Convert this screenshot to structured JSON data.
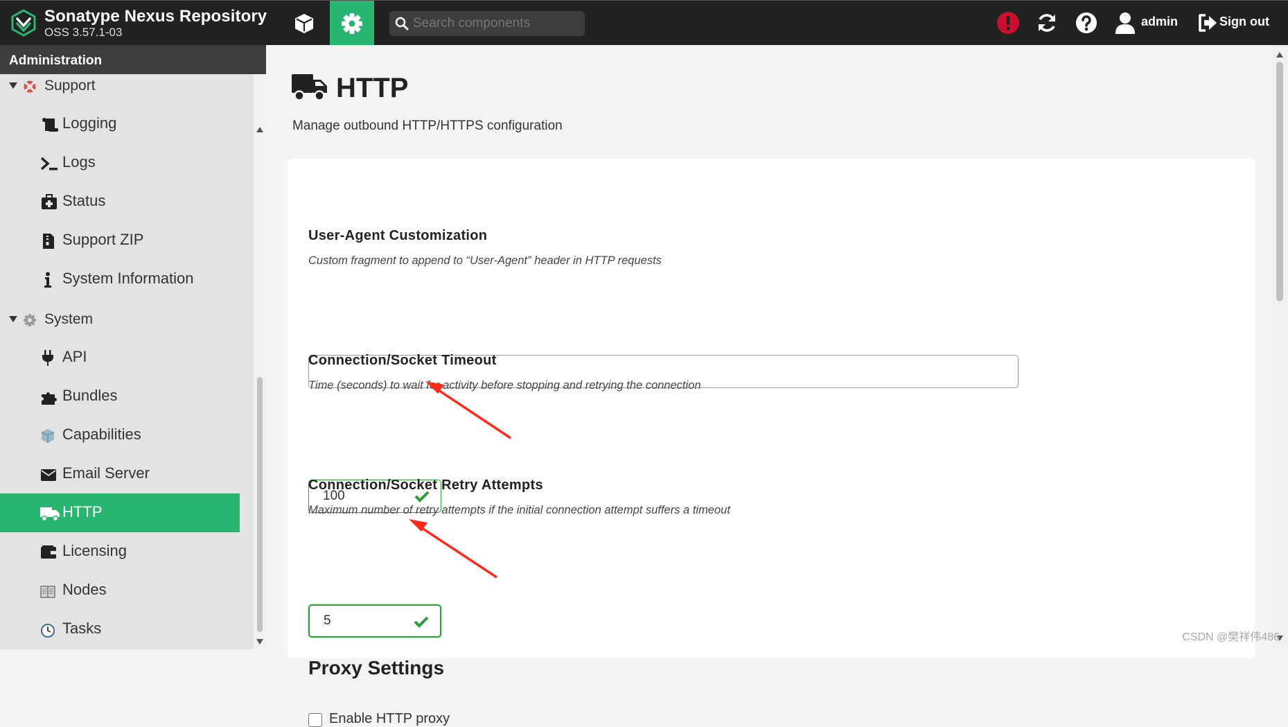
{
  "topbar": {
    "brand_name": "Sonatype Nexus Repository",
    "brand_version": "OSS 3.57.1-03",
    "search_placeholder": "Search components",
    "user_name": "admin",
    "signout_label": "Sign out",
    "icons": [
      "nexus-logo-icon",
      "cube-icon",
      "gear-icon",
      "search-icon",
      "alert-icon",
      "refresh-icon",
      "help-icon",
      "user-icon",
      "sign-out-icon"
    ]
  },
  "sidebar": {
    "header": "Administration",
    "groups": [
      {
        "label": "Support",
        "items": [
          "Logging",
          "Logs",
          "Status",
          "Support ZIP",
          "System Information"
        ]
      },
      {
        "label": "System",
        "items": [
          "API",
          "Bundles",
          "Capabilities",
          "Email Server",
          "HTTP",
          "Licensing",
          "Nodes",
          "Tasks"
        ]
      }
    ],
    "active_item": "HTTP"
  },
  "page": {
    "title": "HTTP",
    "subtitle": "Manage outbound HTTP/HTTPS configuration"
  },
  "form": {
    "user_agent": {
      "label": "User-Agent Customization",
      "description": "Custom fragment to append to “User-Agent” header in HTTP requests",
      "value": ""
    },
    "timeout": {
      "label": "Connection/Socket Timeout",
      "description": "Time (seconds) to wait for activity before stopping and retrying the connection",
      "value": "100"
    },
    "retry": {
      "label": "Connection/Socket Retry Attempts",
      "description": "Maximum number of retry attempts if the initial connection attempt suffers a timeout",
      "value": "5"
    },
    "proxy_heading": "Proxy Settings",
    "enable_http_proxy_label": "Enable HTTP proxy",
    "enable_http_proxy_checked": false
  },
  "watermark": "CSDN @樊祥伟486",
  "colors": {
    "accent": "#27b56f",
    "topbar": "#222222",
    "valid": "#2e9e3a",
    "annotation_arrow": "#ff2a1a",
    "alert": "#c8102e"
  }
}
